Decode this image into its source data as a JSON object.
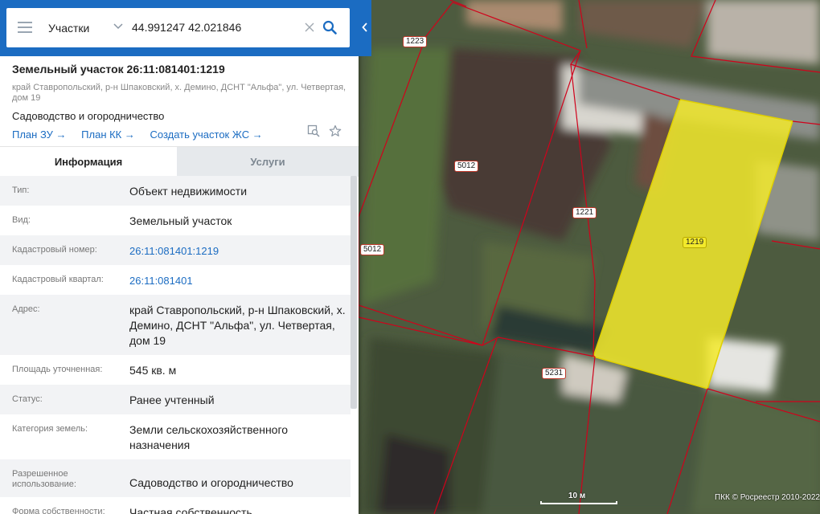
{
  "search": {
    "type_label": "Участки",
    "query": "44.991247 42.021846"
  },
  "plot": {
    "title": "Земельный участок 26:11:081401:1219",
    "address": "край Ставропольский, р-н Шпаковский, х. Демино, ДСНТ \"Альфа\", ул. Четвертая, дом 19",
    "use": "Садоводство и огородничество",
    "links": [
      "План ЗУ →",
      "План КК →",
      "Создать участок ЖС →"
    ]
  },
  "tabs": {
    "info": "Информация",
    "services": "Услуги"
  },
  "attributes": [
    {
      "key": "Тип:",
      "value": "Объект недвижимости"
    },
    {
      "key": "Вид:",
      "value": "Земельный участок"
    },
    {
      "key": "Кадастровый номер:",
      "value": "26:11:081401:1219"
    },
    {
      "key": "Кадастровый квартал:",
      "value": "26:11:081401"
    },
    {
      "key": "Адрес:",
      "value": "край Ставропольский, р-н Шпаковский, х. Демино, ДСНТ \"Альфа\", ул. Четвертая, дом 19"
    },
    {
      "key": "Площадь уточненная:",
      "value": "545 кв. м"
    },
    {
      "key": "Статус:",
      "value": "Ранее учтенный"
    },
    {
      "key": "Категория земель:",
      "value": "Земли сельскохозяйственного назначения"
    },
    {
      "key": "Разрешенное использование:",
      "value": "Садоводство и огородничество"
    },
    {
      "key": "Форма собственности:",
      "value": "Частная собственность"
    }
  ],
  "map": {
    "parcel_labels": [
      "1223",
      "5012",
      "1221",
      "5012",
      "1219",
      "5231"
    ],
    "scale": "10 м",
    "copyright": "ПКК © Росреестр 2010-2022"
  },
  "colors": {
    "header_blue": "#1b6cc2",
    "boundary_red": "#d0021b",
    "selected_fill": "#f3ea2b"
  },
  "icons": [
    "menu-icon",
    "chevron-down-icon",
    "close-icon",
    "search-icon",
    "chevron-left-icon",
    "map-search-icon",
    "star-icon"
  ]
}
